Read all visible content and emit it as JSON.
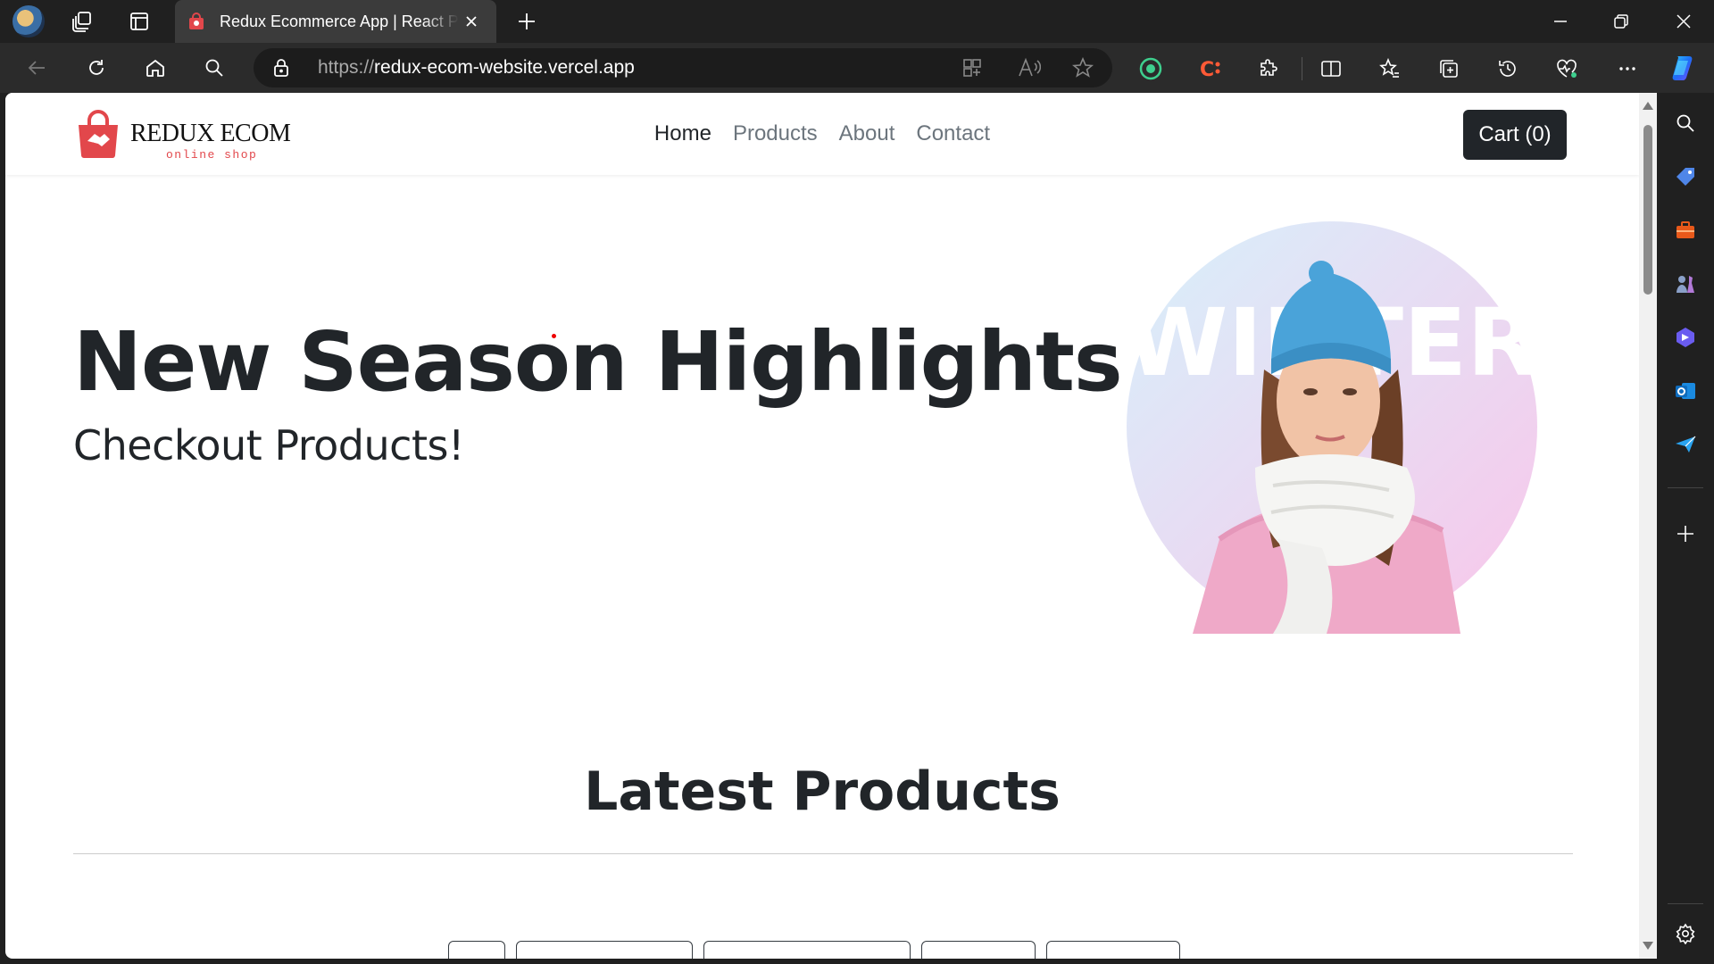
{
  "browser": {
    "tab_title": "Redux Ecommerce App | React Project",
    "url_protocol": "https://",
    "url_domain": "redux-ecom-website.vercel.app",
    "icons": [
      "profile-avatar",
      "workspaces-icon",
      "tab-actions-icon",
      "close-icon",
      "plus-icon",
      "minimize-icon",
      "restore-icon",
      "close-window-icon",
      "back-icon",
      "refresh-icon",
      "home-icon",
      "search-icon",
      "lock-icon",
      "app-available-icon",
      "read-aloud-icon",
      "favorite-star-icon",
      "extension-icon",
      "puzzle-icon",
      "split-screen-icon",
      "favorites-icon",
      "collections-icon",
      "history-icon",
      "performance-icon",
      "more-icon",
      "copilot-icon"
    ]
  },
  "sidebar": {
    "items": [
      "search-icon",
      "shopping-tag-icon",
      "tools-icon",
      "games-icon",
      "copilot-icon",
      "outlook-icon",
      "send-icon",
      "add-icon",
      "settings-icon"
    ]
  },
  "site": {
    "brand_name": "REDUX ECOM",
    "brand_tagline": "online shop",
    "nav": {
      "home": "Home",
      "products": "Products",
      "about": "About",
      "contact": "Contact"
    },
    "cart_label": "Cart (0)"
  },
  "hero": {
    "title": "New Season Highlights",
    "subtitle": "Checkout Products!",
    "image_text": "WINTER"
  },
  "latest": {
    "title": "Latest Products",
    "filter_buttons": [
      "",
      "",
      "",
      "",
      ""
    ]
  },
  "colors": {
    "brand_red": "#e2474b",
    "dark": "#212529",
    "muted": "#6c757d",
    "chrome_bg": "#202020",
    "toolbar_bg": "#2b2b2b"
  }
}
